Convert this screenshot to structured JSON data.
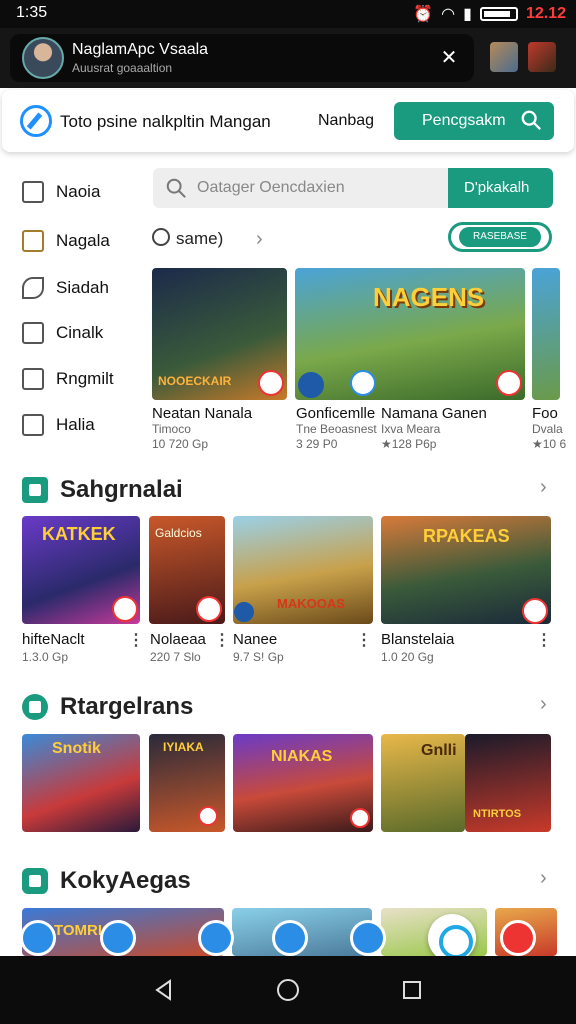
{
  "status_bar": {
    "time": "1:35",
    "clock": "12.12"
  },
  "profile": {
    "name": "NaglamApc Vsaala",
    "subtitle": "Auusrat goaaaltion"
  },
  "header": {
    "title": "Toto psine nalkpltin Mangan",
    "link": "Nanbag",
    "button_label": "Pencgsakm"
  },
  "sidebar": {
    "items": [
      {
        "label": "Naoia",
        "icon": "info-icon"
      },
      {
        "label": "Nagala",
        "icon": "box-icon"
      },
      {
        "label": "Siadah",
        "icon": "pencil-icon"
      },
      {
        "label": "Cinalk",
        "icon": "chat-icon"
      },
      {
        "label": "Rngmilt",
        "icon": "comment-icon"
      },
      {
        "label": "Halia",
        "icon": "bag-icon"
      }
    ]
  },
  "search": {
    "placeholder": "Oatager Oencdaxien",
    "button_label": "D'pkakalh"
  },
  "filter": {
    "label": "same)",
    "button_label": "RASEBASE"
  },
  "featured": [
    {
      "title": "Neatan Nanala",
      "subtitle": "Timoco",
      "meta": "10 720 Gp"
    },
    {
      "title": "Gonficemlle",
      "subtitle": "Tne Beoasnest",
      "meta": "3 29 P0"
    },
    {
      "title": "Namana Ganen",
      "subtitle": "Ixva Meara",
      "meta": "★128 P6p"
    },
    {
      "title": "Foo",
      "subtitle": "Dvala",
      "meta": "★10 6"
    }
  ],
  "featured_art": [
    "NOOECKAIR",
    "NAGENS",
    "",
    ""
  ],
  "sections": [
    {
      "title": "Sahgrnalai",
      "items": [
        {
          "title": "hifteNaclt",
          "meta": "1.3.0 Gp",
          "art": "KATKEK"
        },
        {
          "title": "Nolaeaa",
          "meta": "220 7 Slo",
          "art": "Galdcios"
        },
        {
          "title": "Nanee",
          "meta": "9.7 S! Gp",
          "art": "MAKOOAS"
        },
        {
          "title": "Blanstelaia",
          "meta": "1.0 20 Gg",
          "art": "RPAKEAS"
        }
      ]
    },
    {
      "title": "Rtargelrans",
      "items": [
        {
          "art": "Snotik"
        },
        {
          "art": "IYIAKA"
        },
        {
          "art": "NIAKAS"
        },
        {
          "art": "Gnlli"
        },
        {
          "art": "NTIRTOS"
        }
      ]
    },
    {
      "title": "KokyAegas",
      "items": [
        {
          "art": "TOMRIC"
        },
        {
          "art": ""
        },
        {
          "art": ""
        },
        {
          "art": ""
        }
      ]
    }
  ],
  "colors": {
    "accent": "#1a9b80",
    "status_clock": "#ff3b3b",
    "badge_red": "#e33333",
    "blue": "#2b8de6"
  }
}
